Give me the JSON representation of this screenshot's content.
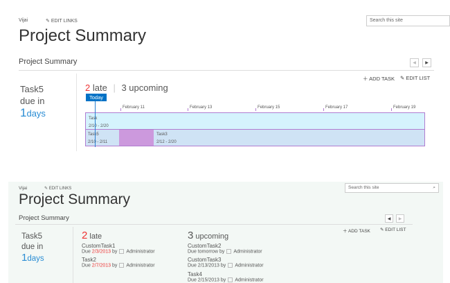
{
  "top": {
    "user": "Vijai",
    "edit_links": "EDIT LINKS",
    "title": "Project Summary",
    "search_placeholder": "Search this site",
    "section": "Project Summary",
    "add_task": "ADD TASK",
    "edit_list": "EDIT LIST",
    "due": {
      "task": "Task5",
      "due_in": "due in",
      "num": "1",
      "unit": "days"
    },
    "late_count": "2",
    "late_label": "late",
    "separator": "|",
    "upcoming_label": "3 upcoming",
    "today": "Today",
    "ticks": [
      "February 11",
      "February 13",
      "February 15",
      "February 17",
      "February 19"
    ],
    "bars": [
      {
        "name": "Task",
        "dates": "2/10 - 2/20"
      },
      {
        "name": "Task5",
        "dates": "2/10 - 2/11"
      },
      {
        "name": "Task3",
        "dates": "2/12 - 2/20"
      }
    ]
  },
  "bottom": {
    "user": "Vijai",
    "edit_links": "EDIT LINKS",
    "title": "Project Summary",
    "search_placeholder": "Search this site",
    "section": "Project Summary",
    "add_task": "ADD TASK",
    "edit_list": "EDIT LIST",
    "due": {
      "task": "Task5",
      "due_in": "due in",
      "num": "1",
      "unit": "days"
    },
    "late": {
      "count": "2",
      "label": "late",
      "items": [
        {
          "name": "CustomTask1",
          "due": "Due",
          "date": "2/3/2013",
          "by": "by",
          "who": "Administrator"
        },
        {
          "name": "Task2",
          "due": "Due",
          "date": "2/7/2013",
          "by": "by",
          "who": "Administrator"
        }
      ]
    },
    "upcoming": {
      "count": "3",
      "label": "upcoming",
      "items": [
        {
          "name": "CustomTask2",
          "due": "Due",
          "date": "tomorrow",
          "by": "by",
          "who": "Administrator"
        },
        {
          "name": "CustomTask3",
          "due": "Due",
          "date": "2/13/2013",
          "by": "by",
          "who": "Administrator"
        },
        {
          "name": "Task4",
          "due": "Due",
          "date": "2/15/2013",
          "by": "by",
          "who": "Administrator"
        }
      ]
    }
  }
}
